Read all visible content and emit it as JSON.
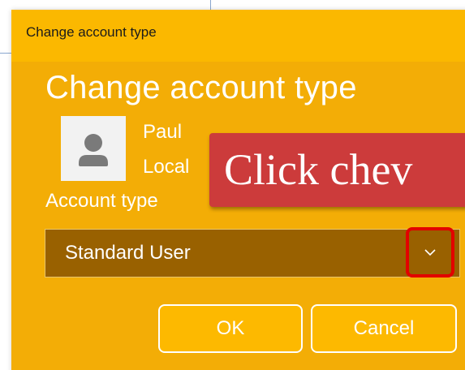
{
  "window": {
    "title": "Change account type"
  },
  "dialog": {
    "heading": "Change account type",
    "user": {
      "name": "Paul",
      "account_kind": "Local"
    },
    "account_type_label": "Account type",
    "account_type_selected": "Standard User",
    "buttons": {
      "ok": "OK",
      "cancel": "Cancel"
    }
  },
  "callout": {
    "text": "Click chev"
  },
  "icons": {
    "avatar": "person-icon",
    "dropdown": "chevron-down-icon"
  },
  "colors": {
    "dialog_background": "#f3ad06",
    "titlebar_background": "#fbb800",
    "select_background": "#996100",
    "highlight_border": "#e20000",
    "callout_background": "#cc3b3b"
  }
}
